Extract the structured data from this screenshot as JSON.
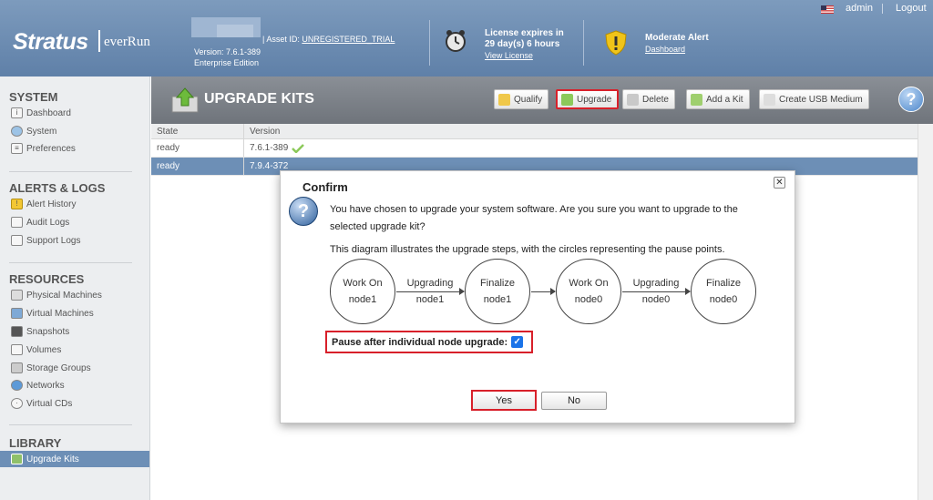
{
  "header": {
    "logo_text": "Stratus",
    "logo_product": "everRun",
    "version_line": "Version: 7.6.1-389",
    "edition": "Enterprise Edition",
    "asset_label": "| Asset ID:",
    "asset_link": "UNREGISTERED_TRIAL",
    "license_line1": "License expires in",
    "license_line2": "29 day(s) 6 hours",
    "license_link": "View License",
    "alert_title": "Moderate Alert",
    "alert_link": "Dashboard",
    "user": "admin",
    "logout": "Logout"
  },
  "sidebar": {
    "sections": [
      {
        "title": "SYSTEM",
        "items": [
          {
            "label": "Dashboard",
            "icon": "i"
          },
          {
            "label": "System",
            "icon": "globe"
          },
          {
            "label": "Preferences",
            "icon": "prefs"
          }
        ]
      },
      {
        "title": "ALERTS & LOGS",
        "items": [
          {
            "label": "Alert History",
            "icon": "warning"
          },
          {
            "label": "Audit Logs",
            "icon": "doc"
          },
          {
            "label": "Support Logs",
            "icon": "doc"
          }
        ]
      },
      {
        "title": "RESOURCES",
        "items": [
          {
            "label": "Physical Machines",
            "icon": "server"
          },
          {
            "label": "Virtual Machines",
            "icon": "vm"
          },
          {
            "label": "Snapshots",
            "icon": "camera"
          },
          {
            "label": "Volumes",
            "icon": "volume"
          },
          {
            "label": "Storage Groups",
            "icon": "storage"
          },
          {
            "label": "Networks",
            "icon": "network"
          },
          {
            "label": "Virtual CDs",
            "icon": "cd"
          }
        ]
      },
      {
        "title": "LIBRARY",
        "items": [
          {
            "label": "Upgrade Kits",
            "icon": "kit",
            "active": true
          }
        ]
      }
    ]
  },
  "toolbar": {
    "title": "UPGRADE KITS",
    "buttons": {
      "qualify": "Qualify",
      "upgrade": "Upgrade",
      "delete": "Delete",
      "add_kit": "Add a Kit",
      "usb": "Create USB Medium"
    },
    "help": "?"
  },
  "table": {
    "headers": [
      "State",
      "Version"
    ],
    "rows": [
      {
        "state": "ready",
        "version": "7.6.1-389",
        "installed": true
      },
      {
        "state": "ready",
        "version": "7.9.4-372",
        "selected": true
      }
    ]
  },
  "dialog": {
    "title": "Confirm",
    "close": "✕",
    "message": "You have chosen to upgrade your system software. Are you sure you want to upgrade to the selected upgrade kit?",
    "diagram_text": "This diagram illustrates the upgrade steps, with the circles representing the pause points.",
    "steps": {
      "c1a": "Work On",
      "c1b": "node1",
      "l1a": "Upgrading",
      "l1b": "node1",
      "c2a": "Finalize",
      "c2b": "node1",
      "c3a": "Work On",
      "c3b": "node0",
      "l2a": "Upgrading",
      "l2b": "node0",
      "c4a": "Finalize",
      "c4b": "node0"
    },
    "pause_label": "Pause after individual node upgrade:",
    "pause_checked": true,
    "yes": "Yes",
    "no": "No"
  },
  "colors": {
    "header": "#6b8cb3",
    "selection": "#6d8fb6",
    "highlight": "#d8202a"
  }
}
